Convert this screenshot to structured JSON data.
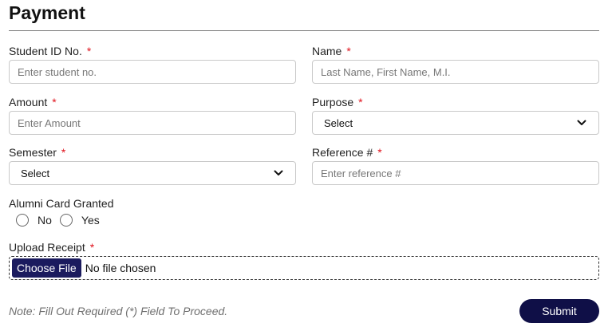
{
  "page": {
    "title": "Payment"
  },
  "form": {
    "student_id": {
      "label": "Student ID No.",
      "required": "*",
      "placeholder": "Enter student no."
    },
    "name": {
      "label": "Name",
      "required": "*",
      "placeholder": "Last Name, First Name, M.I."
    },
    "amount": {
      "label": "Amount",
      "required": "*",
      "placeholder": "Enter Amount"
    },
    "purpose": {
      "label": "Purpose",
      "required": "*",
      "selected": "Select"
    },
    "semester": {
      "label": "Semester",
      "required": "*",
      "selected": "Select"
    },
    "reference": {
      "label": "Reference #",
      "required": "*",
      "placeholder": "Enter reference #"
    },
    "alumni_card": {
      "label": "Alumni Card Granted",
      "options": [
        "No",
        "Yes"
      ]
    },
    "upload": {
      "label": "Upload Receipt",
      "required": "*",
      "button_label": "Choose File",
      "status": "No file chosen"
    }
  },
  "footer": {
    "note": "Note: Fill Out Required (*) Field To Proceed.",
    "submit_label": "Submit"
  },
  "colors": {
    "accent": "#0f0f47",
    "required": "#e0141e",
    "file_button": "#1b1b5e"
  }
}
